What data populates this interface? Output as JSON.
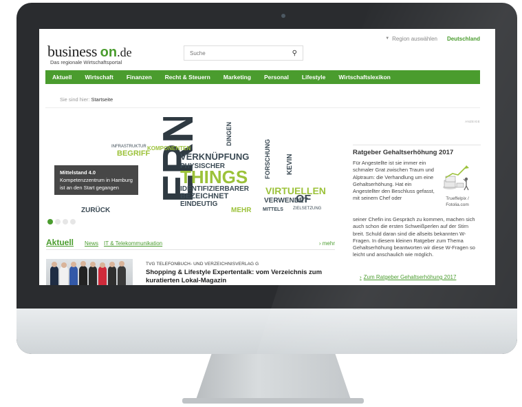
{
  "region": {
    "select_label": "Region auswählen",
    "current": "Deutschland"
  },
  "logo": {
    "word": "business",
    "on": "on",
    "tld": ".de",
    "subtitle": "Das regionale Wirtschaftsportal"
  },
  "search": {
    "placeholder": "Suche"
  },
  "nav": {
    "items": [
      "Aktuell",
      "Wirtschaft",
      "Finanzen",
      "Recht & Steuern",
      "Marketing",
      "Personal",
      "Lifestyle",
      "Wirtschaftslexikon"
    ]
  },
  "breadcrumb": {
    "prefix": "Sie sind hier:",
    "current": "Startseite"
  },
  "ad_label": "ANZEIGE",
  "hero": {
    "caption_title": "Mittelstand 4.0",
    "caption_text": "Kompetenzzentrum in Hamburg ist an den Start gegangen",
    "words": [
      "ERNE",
      "THINGS",
      "VERKNÜPFUNG",
      "PHYSISCHER",
      "IDENTIFIZIERBARER",
      "BEZEICHNET",
      "VIRTUELLEN",
      "VERWENDET",
      "EINDEUTIG",
      "MEHR",
      "MITTELS",
      "KOMPONENTEN",
      "BEGRIFF",
      "ZURÜCK",
      "FORSCHUNG",
      "DINGEN",
      "INFRASTRUKTUR",
      "OF",
      "KEVIN",
      "ZIELSETZUNG"
    ]
  },
  "aktuell": {
    "heading": "Aktuell",
    "tabs": [
      "News",
      "IT & Telekommunikation"
    ],
    "more": "› mehr"
  },
  "news": {
    "meta": "TVG TELEFONBUCH- UND VERZEICHNISVERLAG G",
    "title": "Shopping & Lifestyle Expertentalk: vom Verzeichnis zum kuratierten Lokal-Magazin"
  },
  "sidebar": {
    "title": "Ratgeber Gehaltserhöhung 2017",
    "text1": "Für Angestellte ist sie immer ein schmaler Grat zwischen Traum und Alptraum: die Verhandlung um eine Gehaltserhöhung. Hat ein Angestellter den Beschluss gefasst, mit seinem Chef oder",
    "text2": "seiner Chefin ins Gespräch zu kommen, machen sich auch schon die ersten Schweißperlen auf der Stirn breit. Schuld daran sind die allseits bekannten W-Fragen. In diesem kleinen Ratgeber zum Thema Gehaltserhöhung beantworten wir diese W-Fragen so leicht und anschaulich wie möglich.",
    "image_credit": "Trueffelpix / Fotolia.com",
    "link": "Zum Ratgeber Gehaltserhöhung 2017",
    "link_arrow": "›"
  },
  "colors": {
    "brand_green": "#4a9c2e",
    "bezel": "#2a2c2f"
  }
}
